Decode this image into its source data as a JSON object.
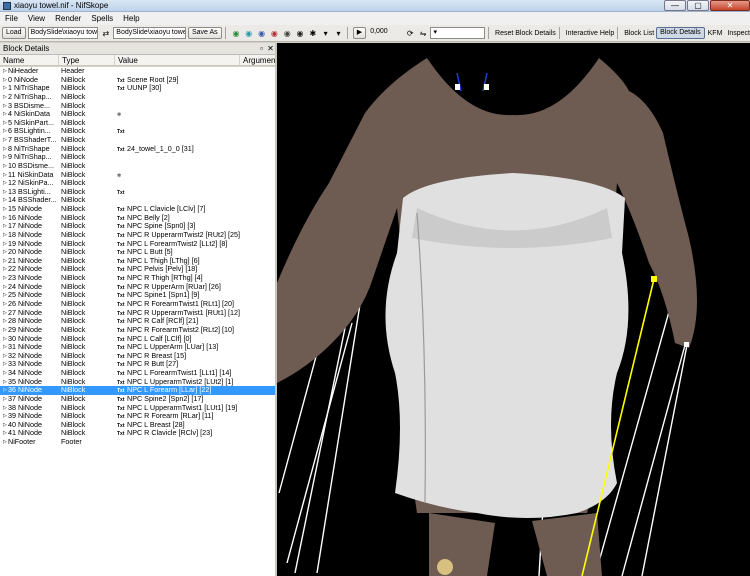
{
  "window": {
    "title": "xiaoyu towel.nif - NifSkope",
    "minimize": "—",
    "maximize": "▢",
    "close": "✕"
  },
  "menu": [
    "File",
    "View",
    "Render",
    "Spells",
    "Help"
  ],
  "toolbar": {
    "load": "Load",
    "load_path": "BodySlide\\xiaoyu towel.nif",
    "save_path": "BodySlide\\xiaoyu towel.nif",
    "save_as": "Save As",
    "time_value": "0,000",
    "reset_block_details": "Reset Block Details",
    "interactive_help": "Interactive Help",
    "block_list": "Block List",
    "block_details": "Block Details",
    "kfm": "KFM",
    "inspect": "Inspect"
  },
  "panel": {
    "title": "Block Details",
    "columns": [
      "Name",
      "Type",
      "Value",
      "Argument"
    ],
    "rows": [
      {
        "name": "NiHeader",
        "type": "Header",
        "value": "",
        "kind": ""
      },
      {
        "name": "0 NiNode",
        "type": "NiBlock",
        "value": "Scene Root [29]",
        "kind": "txt"
      },
      {
        "name": "1 NiTriShape",
        "type": "NiBlock",
        "value": "UUNP [30]",
        "kind": "txt"
      },
      {
        "name": "2 NiTriShap...",
        "type": "NiBlock",
        "value": "",
        "kind": ""
      },
      {
        "name": "3 BSDisme...",
        "type": "NiBlock",
        "value": "",
        "kind": ""
      },
      {
        "name": "4 NiSkinData",
        "type": "NiBlock",
        "value": "",
        "kind": "icon"
      },
      {
        "name": "5 NiSkinPart...",
        "type": "NiBlock",
        "value": "",
        "kind": ""
      },
      {
        "name": "6 BSLightin...",
        "type": "NiBlock",
        "value": "",
        "kind": "txt"
      },
      {
        "name": "7 BSShaderT...",
        "type": "NiBlock",
        "value": "",
        "kind": ""
      },
      {
        "name": "8 NiTriShape",
        "type": "NiBlock",
        "value": "24_towel_1_0_0 [31]",
        "kind": "txt"
      },
      {
        "name": "9 NiTriShap...",
        "type": "NiBlock",
        "value": "",
        "kind": ""
      },
      {
        "name": "10 BSDisme...",
        "type": "NiBlock",
        "value": "",
        "kind": ""
      },
      {
        "name": "11 NiSkinData",
        "type": "NiBlock",
        "value": "",
        "kind": "icon"
      },
      {
        "name": "12 NiSkinPa...",
        "type": "NiBlock",
        "value": "",
        "kind": ""
      },
      {
        "name": "13 BSLighti...",
        "type": "NiBlock",
        "value": "",
        "kind": "txt"
      },
      {
        "name": "14 BSShader...",
        "type": "NiBlock",
        "value": "",
        "kind": ""
      },
      {
        "name": "15 NiNode",
        "type": "NiBlock",
        "value": "NPC L Clavicle [LClv] [7]",
        "kind": "txt"
      },
      {
        "name": "16 NiNode",
        "type": "NiBlock",
        "value": "NPC Belly [2]",
        "kind": "txt"
      },
      {
        "name": "17 NiNode",
        "type": "NiBlock",
        "value": "NPC Spine [Spn0] [3]",
        "kind": "txt"
      },
      {
        "name": "18 NiNode",
        "type": "NiBlock",
        "value": "NPC R UpperarmTwist2 [RUt2] [25]",
        "kind": "txt"
      },
      {
        "name": "19 NiNode",
        "type": "NiBlock",
        "value": "NPC L ForearmTwist2 [LLt2] [8]",
        "kind": "txt"
      },
      {
        "name": "20 NiNode",
        "type": "NiBlock",
        "value": "NPC L Butt [5]",
        "kind": "txt"
      },
      {
        "name": "21 NiNode",
        "type": "NiBlock",
        "value": "NPC L Thigh [LThg] [6]",
        "kind": "txt"
      },
      {
        "name": "22 NiNode",
        "type": "NiBlock",
        "value": "NPC Pelvis [Pelv] [18]",
        "kind": "txt"
      },
      {
        "name": "23 NiNode",
        "type": "NiBlock",
        "value": "NPC R Thigh [RThg] [4]",
        "kind": "txt"
      },
      {
        "name": "24 NiNode",
        "type": "NiBlock",
        "value": "NPC R UpperArm [RUar] [26]",
        "kind": "txt"
      },
      {
        "name": "25 NiNode",
        "type": "NiBlock",
        "value": "NPC Spine1 [Spn1] [9]",
        "kind": "txt"
      },
      {
        "name": "26 NiNode",
        "type": "NiBlock",
        "value": "NPC R ForearmTwist1 [RLt1] [20]",
        "kind": "txt"
      },
      {
        "name": "27 NiNode",
        "type": "NiBlock",
        "value": "NPC R UpperarmTwist1 [RUt1] [12]",
        "kind": "txt"
      },
      {
        "name": "28 NiNode",
        "type": "NiBlock",
        "value": "NPC R Calf [RClf] [21]",
        "kind": "txt"
      },
      {
        "name": "29 NiNode",
        "type": "NiBlock",
        "value": "NPC R ForearmTwist2 [RLt2] [10]",
        "kind": "txt"
      },
      {
        "name": "30 NiNode",
        "type": "NiBlock",
        "value": "NPC L Calf [LClf] [0]",
        "kind": "txt"
      },
      {
        "name": "31 NiNode",
        "type": "NiBlock",
        "value": "NPC L UpperArm [LUar] [13]",
        "kind": "txt"
      },
      {
        "name": "32 NiNode",
        "type": "NiBlock",
        "value": "NPC R Breast [15]",
        "kind": "txt"
      },
      {
        "name": "33 NiNode",
        "type": "NiBlock",
        "value": "NPC R Butt [27]",
        "kind": "txt"
      },
      {
        "name": "34 NiNode",
        "type": "NiBlock",
        "value": "NPC L ForearmTwist1 [LLt1] [14]",
        "kind": "txt"
      },
      {
        "name": "35 NiNode",
        "type": "NiBlock",
        "value": "NPC L UpperarmTwist2 [LUt2] [1]",
        "kind": "txt"
      },
      {
        "name": "36 NiNode",
        "type": "NiBlock",
        "value": "NPC L Forearm [LLar] [22]",
        "kind": "txt",
        "selected": true
      },
      {
        "name": "37 NiNode",
        "type": "NiBlock",
        "value": "NPC Spine2 [Spn2] [17]",
        "kind": "txt"
      },
      {
        "name": "38 NiNode",
        "type": "NiBlock",
        "value": "NPC L UpperarmTwist1 [LUt1] [19]",
        "kind": "txt"
      },
      {
        "name": "39 NiNode",
        "type": "NiBlock",
        "value": "NPC R Forearm [RLar] [11]",
        "kind": "txt"
      },
      {
        "name": "40 NiNode",
        "type": "NiBlock",
        "value": "NPC L Breast [28]",
        "kind": "txt"
      },
      {
        "name": "41 NiNode",
        "type": "NiBlock",
        "value": "NPC R Clavicle [RClv] [23]",
        "kind": "txt"
      },
      {
        "name": "NiFooter",
        "type": "Footer",
        "value": "",
        "kind": ""
      }
    ]
  },
  "viewport": {
    "background": "#000000",
    "skin_color": "#6e5b52",
    "towel_color": "#e2e2e2",
    "bone_color": "#ffffff",
    "selected_bone_color": "#ffff00"
  }
}
